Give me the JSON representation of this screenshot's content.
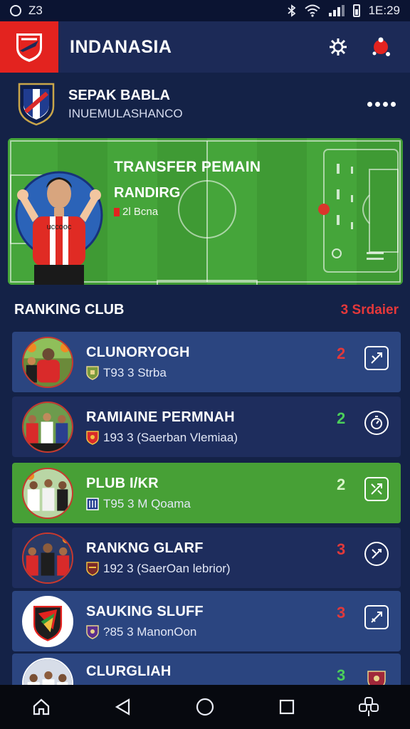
{
  "status_bar": {
    "time_left": "Z3",
    "time_right": "1E:29"
  },
  "app_bar": {
    "title": "INDANASIA"
  },
  "club": {
    "name": "SEPAK BABLA",
    "subtitle": "INUEMULASHANCO"
  },
  "banner": {
    "title": "TRANSFER PEMAIN",
    "subtitle": "RANDIRG",
    "meta": "2l Bcna",
    "player_shirt": "uccooc"
  },
  "ranking": {
    "title": "RANKING CLUB",
    "action": "3 Srdaier"
  },
  "rows": [
    {
      "name": "CLUNORYOGH",
      "sub": "T93 3 Strba",
      "rank": "2",
      "rank_color": "red"
    },
    {
      "name": "RAMIAINE PERMNAH",
      "sub": "193 3 (Saerban Vlemiaa)",
      "rank": "2",
      "rank_color": "green"
    },
    {
      "name": "PLUB I/KR",
      "sub": "T95 3 M Qoama",
      "rank": "2",
      "rank_color": "green"
    },
    {
      "name": "RANKNG GLARF",
      "sub": "192 3 (SaerOan lebrior)",
      "rank": "3",
      "rank_color": "red"
    },
    {
      "name": "SAUKING SLUFF",
      "sub": "?85 3 ManonOon",
      "rank": "3",
      "rank_color": "red"
    },
    {
      "name": "CLURGLIAH",
      "sub": "",
      "rank": "3",
      "rank_color": "green"
    }
  ],
  "colors": {
    "brand_red": "#e3231f",
    "app_bar": "#1c2a57",
    "background": "#142247",
    "pitch_green": "#3f9a34"
  },
  "icons": [
    "bell-settings-icon",
    "profile-icon",
    "more-icon",
    "home-icon",
    "back-icon",
    "circle-home-icon",
    "recents-icon",
    "menu-icon"
  ]
}
